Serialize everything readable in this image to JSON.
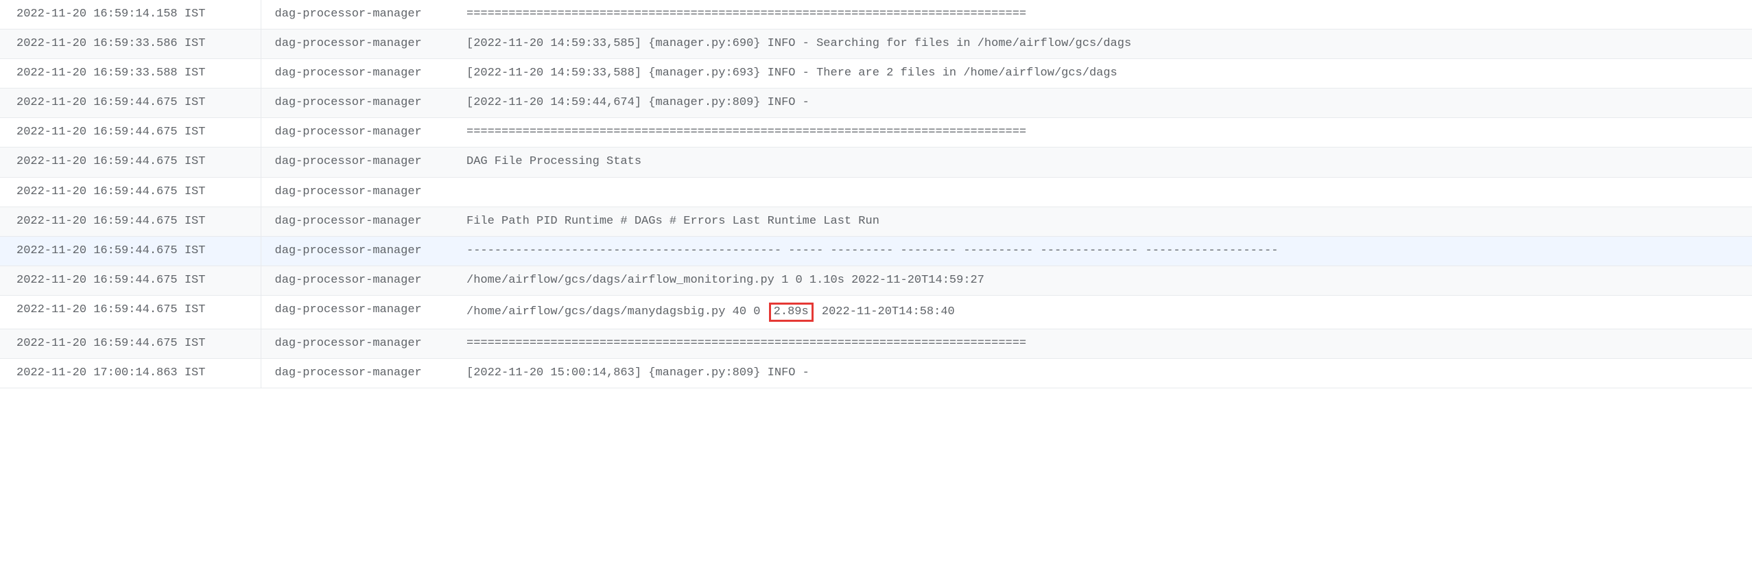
{
  "logs": [
    {
      "timestamp": "2022-11-20 16:59:14.158 IST",
      "source": "dag-processor-manager",
      "message": "================================================================================",
      "highlighted": false
    },
    {
      "timestamp": "2022-11-20 16:59:33.586 IST",
      "source": "dag-processor-manager",
      "message": "[2022-11-20 14:59:33,585] {manager.py:690} INFO - Searching for files in /home/airflow/gcs/dags",
      "highlighted": false
    },
    {
      "timestamp": "2022-11-20 16:59:33.588 IST",
      "source": "dag-processor-manager",
      "message": "[2022-11-20 14:59:33,588] {manager.py:693} INFO - There are 2 files in /home/airflow/gcs/dags",
      "highlighted": false
    },
    {
      "timestamp": "2022-11-20 16:59:44.675 IST",
      "source": "dag-processor-manager",
      "message": "[2022-11-20 14:59:44,674] {manager.py:809} INFO - ",
      "highlighted": false
    },
    {
      "timestamp": "2022-11-20 16:59:44.675 IST",
      "source": "dag-processor-manager",
      "message": "================================================================================",
      "highlighted": false
    },
    {
      "timestamp": "2022-11-20 16:59:44.675 IST",
      "source": "dag-processor-manager",
      "message": "DAG File Processing Stats",
      "highlighted": false
    },
    {
      "timestamp": "2022-11-20 16:59:44.675 IST",
      "source": "dag-processor-manager",
      "message": "",
      "highlighted": false
    },
    {
      "timestamp": "2022-11-20 16:59:44.675 IST",
      "source": "dag-processor-manager",
      "message": "File Path PID Runtime # DAGs # Errors Last Runtime Last Run",
      "highlighted": false
    },
    {
      "timestamp": "2022-11-20 16:59:44.675 IST",
      "source": "dag-processor-manager",
      "message": "--------------------------------------------- ----- --------- -------- ---------- -------------- -------------------",
      "highlighted": false,
      "hovered": true
    },
    {
      "timestamp": "2022-11-20 16:59:44.675 IST",
      "source": "dag-processor-manager",
      "message": "/home/airflow/gcs/dags/airflow_monitoring.py 1 0 1.10s 2022-11-20T14:59:27",
      "highlighted": false
    },
    {
      "timestamp": "2022-11-20 16:59:44.675 IST",
      "source": "dag-processor-manager",
      "message_pre": "/home/airflow/gcs/dags/manydagsbig.py 40 0 ",
      "message_highlight": "2.89s",
      "message_post": " 2022-11-20T14:58:40",
      "highlighted": true
    },
    {
      "timestamp": "2022-11-20 16:59:44.675 IST",
      "source": "dag-processor-manager",
      "message": "================================================================================",
      "highlighted": false
    },
    {
      "timestamp": "2022-11-20 17:00:14.863 IST",
      "source": "dag-processor-manager",
      "message": "[2022-11-20 15:00:14,863] {manager.py:809} INFO - ",
      "highlighted": false
    }
  ]
}
